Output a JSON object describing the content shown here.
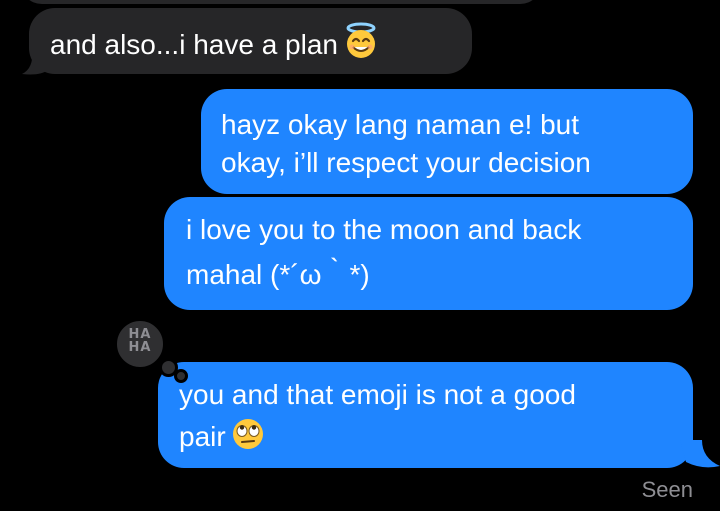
{
  "messages": [
    {
      "direction": "incoming",
      "text": "and also...i have a plan",
      "emoji": "smiling-face-with-halo-icon"
    },
    {
      "direction": "outgoing",
      "line1": "hayz okay lang naman e! but",
      "line2": "okay, i’ll respect your decision"
    },
    {
      "direction": "outgoing",
      "line1": "i love you to the moon and back",
      "line2": "mahal (*´ω｀*)"
    },
    {
      "direction": "outgoing",
      "line1": "you and that emoji is not a good",
      "line2": "pair",
      "emoji": "face-with-rolling-eyes-icon",
      "tapback": "HA\nHA"
    }
  ],
  "status": "Seen",
  "colors": {
    "background": "#000000",
    "incoming_bubble": "#262628",
    "outgoing_bubble": "#1f85ff",
    "status_text": "#8e8e93"
  }
}
